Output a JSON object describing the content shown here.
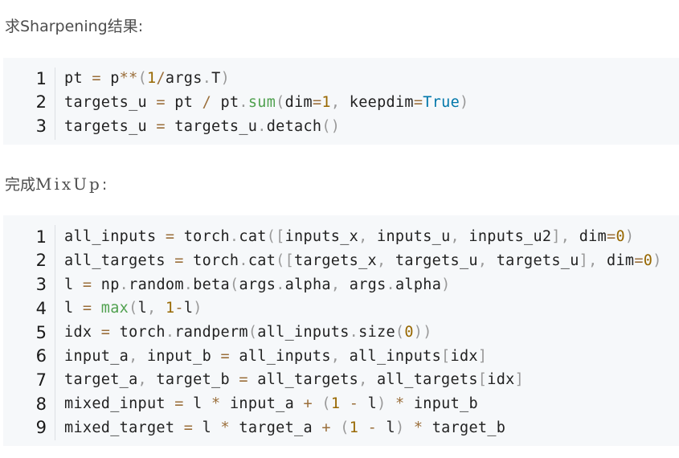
{
  "heading_sharpening": "求Sharpening结果:",
  "heading_mixup_prefix": "完成",
  "heading_mixup_math": "MixUp",
  "heading_mixup_suffix": ":",
  "code_block_1": {
    "lines": [
      {
        "num": "1",
        "tokens": [
          [
            "id",
            "pt "
          ],
          [
            "op",
            "="
          ],
          [
            "id",
            " p"
          ],
          [
            "op",
            "**"
          ],
          [
            "punc",
            "("
          ],
          [
            "num",
            "1"
          ],
          [
            "op",
            "/"
          ],
          [
            "id",
            "args"
          ],
          [
            "punc",
            "."
          ],
          [
            "id",
            "T"
          ],
          [
            "punc",
            ")"
          ]
        ]
      },
      {
        "num": "2",
        "tokens": [
          [
            "id",
            "targets_u "
          ],
          [
            "op",
            "="
          ],
          [
            "id",
            " pt "
          ],
          [
            "op",
            "/"
          ],
          [
            "id",
            " pt"
          ],
          [
            "punc",
            "."
          ],
          [
            "fn",
            "sum"
          ],
          [
            "punc",
            "("
          ],
          [
            "id",
            "dim"
          ],
          [
            "op",
            "="
          ],
          [
            "num",
            "1"
          ],
          [
            "punc",
            ","
          ],
          [
            "id",
            " keepdim"
          ],
          [
            "op",
            "="
          ],
          [
            "kw",
            "True"
          ],
          [
            "punc",
            ")"
          ]
        ]
      },
      {
        "num": "3",
        "tokens": [
          [
            "id",
            "targets_u "
          ],
          [
            "op",
            "="
          ],
          [
            "id",
            " targets_u"
          ],
          [
            "punc",
            "."
          ],
          [
            "id",
            "detach"
          ],
          [
            "punc",
            "()"
          ]
        ]
      }
    ]
  },
  "code_block_2": {
    "lines": [
      {
        "num": "1",
        "tokens": [
          [
            "id",
            "all_inputs "
          ],
          [
            "op",
            "="
          ],
          [
            "id",
            " torch"
          ],
          [
            "punc",
            "."
          ],
          [
            "id",
            "cat"
          ],
          [
            "punc",
            "(["
          ],
          [
            "id",
            "inputs_x"
          ],
          [
            "punc",
            ","
          ],
          [
            "id",
            " inputs_u"
          ],
          [
            "punc",
            ","
          ],
          [
            "id",
            " inputs_u2"
          ],
          [
            "punc",
            "],"
          ],
          [
            "id",
            " dim"
          ],
          [
            "op",
            "="
          ],
          [
            "num",
            "0"
          ],
          [
            "punc",
            ")"
          ]
        ]
      },
      {
        "num": "2",
        "tokens": [
          [
            "id",
            "all_targets "
          ],
          [
            "op",
            "="
          ],
          [
            "id",
            " torch"
          ],
          [
            "punc",
            "."
          ],
          [
            "id",
            "cat"
          ],
          [
            "punc",
            "(["
          ],
          [
            "id",
            "targets_x"
          ],
          [
            "punc",
            ","
          ],
          [
            "id",
            " targets_u"
          ],
          [
            "punc",
            ","
          ],
          [
            "id",
            " targets_u"
          ],
          [
            "punc",
            "],"
          ],
          [
            "id",
            " dim"
          ],
          [
            "op",
            "="
          ],
          [
            "num",
            "0"
          ],
          [
            "punc",
            ")"
          ]
        ]
      },
      {
        "num": "3",
        "tokens": [
          [
            "id",
            "l "
          ],
          [
            "op",
            "="
          ],
          [
            "id",
            " np"
          ],
          [
            "punc",
            "."
          ],
          [
            "id",
            "random"
          ],
          [
            "punc",
            "."
          ],
          [
            "id",
            "beta"
          ],
          [
            "punc",
            "("
          ],
          [
            "id",
            "args"
          ],
          [
            "punc",
            "."
          ],
          [
            "id",
            "alpha"
          ],
          [
            "punc",
            ","
          ],
          [
            "id",
            " args"
          ],
          [
            "punc",
            "."
          ],
          [
            "id",
            "alpha"
          ],
          [
            "punc",
            ")"
          ]
        ]
      },
      {
        "num": "4",
        "tokens": [
          [
            "id",
            "l "
          ],
          [
            "op",
            "="
          ],
          [
            "id",
            " "
          ],
          [
            "fn",
            "max"
          ],
          [
            "punc",
            "("
          ],
          [
            "id",
            "l"
          ],
          [
            "punc",
            ","
          ],
          [
            "id",
            " "
          ],
          [
            "num",
            "1"
          ],
          [
            "op",
            "-"
          ],
          [
            "id",
            "l"
          ],
          [
            "punc",
            ")"
          ]
        ]
      },
      {
        "num": "5",
        "tokens": [
          [
            "id",
            "idx "
          ],
          [
            "op",
            "="
          ],
          [
            "id",
            " torch"
          ],
          [
            "punc",
            "."
          ],
          [
            "id",
            "randperm"
          ],
          [
            "punc",
            "("
          ],
          [
            "id",
            "all_inputs"
          ],
          [
            "punc",
            "."
          ],
          [
            "id",
            "size"
          ],
          [
            "punc",
            "("
          ],
          [
            "num",
            "0"
          ],
          [
            "punc",
            "))"
          ]
        ]
      },
      {
        "num": "6",
        "tokens": [
          [
            "id",
            "input_a"
          ],
          [
            "punc",
            ","
          ],
          [
            "id",
            " input_b "
          ],
          [
            "op",
            "="
          ],
          [
            "id",
            " all_inputs"
          ],
          [
            "punc",
            ","
          ],
          [
            "id",
            " all_inputs"
          ],
          [
            "punc",
            "["
          ],
          [
            "id",
            "idx"
          ],
          [
            "punc",
            "]"
          ]
        ]
      },
      {
        "num": "7",
        "tokens": [
          [
            "id",
            "target_a"
          ],
          [
            "punc",
            ","
          ],
          [
            "id",
            " target_b "
          ],
          [
            "op",
            "="
          ],
          [
            "id",
            " all_targets"
          ],
          [
            "punc",
            ","
          ],
          [
            "id",
            " all_targets"
          ],
          [
            "punc",
            "["
          ],
          [
            "id",
            "idx"
          ],
          [
            "punc",
            "]"
          ]
        ]
      },
      {
        "num": "8",
        "tokens": [
          [
            "id",
            "mixed_input "
          ],
          [
            "op",
            "="
          ],
          [
            "id",
            " l "
          ],
          [
            "op",
            "*"
          ],
          [
            "id",
            " input_a "
          ],
          [
            "op",
            "+"
          ],
          [
            "id",
            " "
          ],
          [
            "punc",
            "("
          ],
          [
            "num",
            "1"
          ],
          [
            "id",
            " "
          ],
          [
            "op",
            "-"
          ],
          [
            "id",
            " l"
          ],
          [
            "punc",
            ")"
          ],
          [
            "id",
            " "
          ],
          [
            "op",
            "*"
          ],
          [
            "id",
            " input_b"
          ]
        ]
      },
      {
        "num": "9",
        "tokens": [
          [
            "id",
            "mixed_target "
          ],
          [
            "op",
            "="
          ],
          [
            "id",
            " l "
          ],
          [
            "op",
            "*"
          ],
          [
            "id",
            " target_a "
          ],
          [
            "op",
            "+"
          ],
          [
            "id",
            " "
          ],
          [
            "punc",
            "("
          ],
          [
            "num",
            "1"
          ],
          [
            "id",
            " "
          ],
          [
            "op",
            "-"
          ],
          [
            "id",
            " l"
          ],
          [
            "punc",
            ")"
          ],
          [
            "id",
            " "
          ],
          [
            "op",
            "*"
          ],
          [
            "id",
            " target_b"
          ]
        ]
      }
    ]
  }
}
